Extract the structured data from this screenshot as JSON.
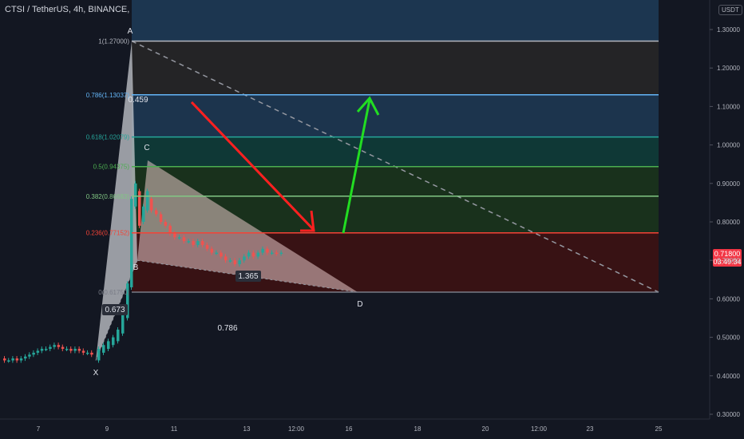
{
  "header": {
    "symbol_title": "CTSI / TetherUS, 4h, BINANCE, Heikin Ashi",
    "unit": "USDT"
  },
  "current_price": {
    "value": "0.71800",
    "countdown": "03:49:34"
  },
  "colors": {
    "bg": "#131722",
    "up": "#26a69a",
    "down": "#ef5350",
    "axis_text": "#b2b5be",
    "band_blue": "#1c3650",
    "band_gray": "#252527",
    "band_teal": "#0f3a38",
    "band_green": "#19331c",
    "band_red": "#3a1214",
    "arrow_down": "#ff2020",
    "arrow_up": "#22dd22"
  },
  "chart_data": {
    "type": "candlestick",
    "title": "CTSI / TetherUS, 4h, BINANCE, Heikin Ashi",
    "y_axis": {
      "ticks": [
        "1.30000",
        "1.20000",
        "1.10000",
        "1.00000",
        "0.90000",
        "0.80000",
        "0.70000",
        "0.60000",
        "0.50000",
        "0.40000",
        "0.30000"
      ],
      "range": [
        0.28,
        1.37
      ]
    },
    "x_axis": {
      "ticks": [
        "7",
        "9",
        "11",
        "13",
        "12:00",
        "16",
        "18",
        "20",
        "12:00",
        "23",
        "25"
      ]
    },
    "fib_levels": [
      {
        "ratio": "1",
        "price": "1.27000",
        "label": "1(1.27000)",
        "value": 1.27
      },
      {
        "ratio": "0.786",
        "price": "1.13037",
        "label": "0.786(1.13037)",
        "value": 1.13037
      },
      {
        "ratio": "0.618",
        "price": "1.02079",
        "label": "0.618(1.02079)",
        "value": 1.02079
      },
      {
        "ratio": "0.5",
        "price": "0.94375",
        "label": "0.5(0.94375)",
        "value": 0.94375
      },
      {
        "ratio": "0.382",
        "price": "0.86683",
        "label": "0.382(0.86683)",
        "value": 0.86683
      },
      {
        "ratio": "0.236",
        "price": "0.77152",
        "label": "0.236(0.77152)",
        "value": 0.77152
      },
      {
        "ratio": "0",
        "price": "0.61750",
        "label": "0(0.61750)",
        "value": 0.6175
      }
    ],
    "pattern_points": [
      {
        "name": "X",
        "value": 0.44
      },
      {
        "name": "A",
        "value": 1.27
      },
      {
        "name": "B",
        "value": 0.7
      },
      {
        "name": "C",
        "value": 0.96
      },
      {
        "name": "D",
        "value": 0.6175
      }
    ],
    "pattern_ratios": [
      "0.459",
      "1.365",
      "0.673",
      "0.786"
    ],
    "current_price": 0.718
  }
}
